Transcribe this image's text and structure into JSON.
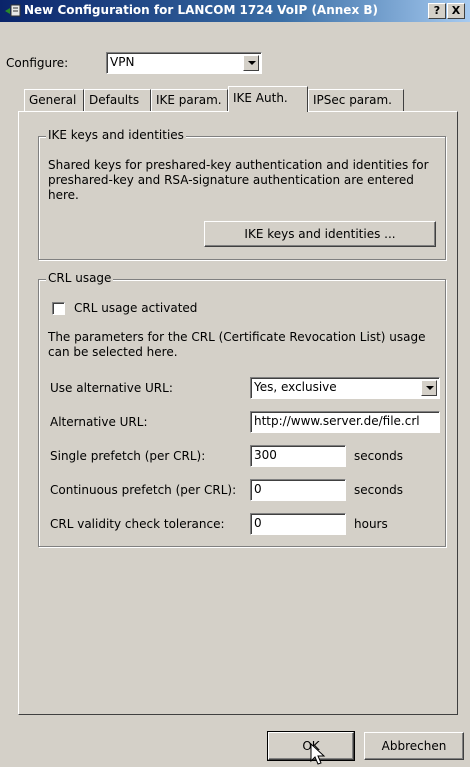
{
  "window": {
    "title": "New Configuration for LANCOM 1724 VoIP (Annex B)",
    "help_label": "?",
    "close_label": "X"
  },
  "configure": {
    "label": "Configure:",
    "value": "VPN"
  },
  "tabs": [
    {
      "label": "General"
    },
    {
      "label": "Defaults"
    },
    {
      "label": "IKE param."
    },
    {
      "label": "IKE Auth.",
      "active": true
    },
    {
      "label": "IPSec param."
    }
  ],
  "ike_group": {
    "title": "IKE keys and identities",
    "description": "Shared keys for preshared-key authentication and identities for preshared-key and RSA-signature authentication are entered here.",
    "button_label": "IKE keys and identities ..."
  },
  "crl_group": {
    "title": "CRL usage",
    "checkbox_label": "CRL usage activated",
    "checkbox_checked": false,
    "description": "The parameters for the CRL (Certificate Revocation List) usage can be selected here.",
    "use_alt_url": {
      "label": "Use alternative URL:",
      "value": "Yes, exclusive"
    },
    "alt_url": {
      "label": "Alternative URL:",
      "value": "http://www.server.de/file.crl"
    },
    "single_prefetch": {
      "label": "Single prefetch (per CRL):",
      "value": "300",
      "unit": "seconds"
    },
    "continuous_prefetch": {
      "label": "Continuous prefetch (per CRL):",
      "value": "0",
      "unit": "seconds"
    },
    "validity_tolerance": {
      "label": "CRL validity check tolerance:",
      "value": "0",
      "unit": "hours"
    }
  },
  "footer": {
    "ok_label": "OK",
    "cancel_label": "Abbrechen"
  }
}
